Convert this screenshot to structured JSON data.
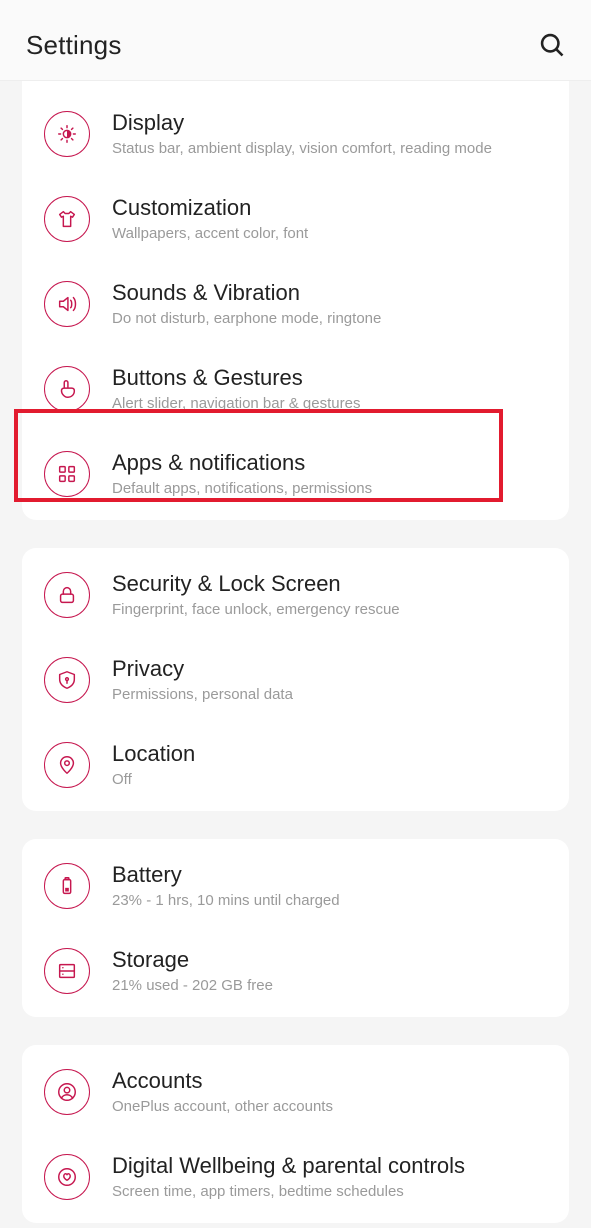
{
  "header": {
    "title": "Settings"
  },
  "accent": "#c6174f",
  "groups": [
    {
      "items": [
        {
          "icon": "brightness",
          "title": "Display",
          "sub": "Status bar, ambient display, vision comfort, reading mode"
        },
        {
          "icon": "shirt",
          "title": "Customization",
          "sub": "Wallpapers, accent color, font"
        },
        {
          "icon": "sound",
          "title": "Sounds & Vibration",
          "sub": "Do not disturb, earphone mode, ringtone"
        },
        {
          "icon": "touch",
          "title": "Buttons & Gestures",
          "sub": "Alert slider, navigation bar & gestures"
        },
        {
          "icon": "apps",
          "title": "Apps & notifications",
          "sub": "Default apps, notifications, permissions",
          "highlighted": true
        }
      ]
    },
    {
      "items": [
        {
          "icon": "lock",
          "title": "Security & Lock Screen",
          "sub": "Fingerprint, face unlock, emergency rescue"
        },
        {
          "icon": "shield",
          "title": "Privacy",
          "sub": "Permissions, personal data"
        },
        {
          "icon": "location",
          "title": "Location",
          "sub": "Off"
        }
      ]
    },
    {
      "items": [
        {
          "icon": "battery",
          "title": "Battery",
          "sub": "23% - 1 hrs, 10 mins until charged"
        },
        {
          "icon": "storage",
          "title": "Storage",
          "sub": "21% used - 202 GB free"
        }
      ]
    },
    {
      "items": [
        {
          "icon": "accounts",
          "title": "Accounts",
          "sub": "OnePlus account, other accounts"
        },
        {
          "icon": "wellbeing",
          "title": "Digital Wellbeing & parental controls",
          "sub": "Screen time, app timers, bedtime schedules"
        }
      ]
    }
  ]
}
